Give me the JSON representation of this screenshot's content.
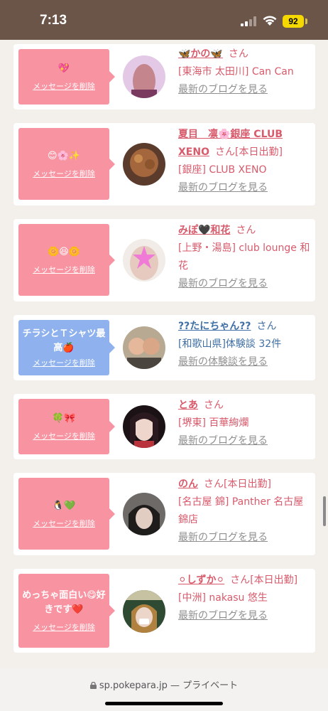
{
  "status_bar": {
    "time": "7:13",
    "battery": "92"
  },
  "common": {
    "delete_label": "メッセージを削除",
    "san": "さん"
  },
  "cards": [
    {
      "message": "💖",
      "name": "🦋かの🦋",
      "extra": "",
      "shop": "[東海市 太田川] Can Can",
      "link": "最新のブログを見る"
    },
    {
      "message": "😊🌸✨",
      "name": "夏目　凛🌸銀座 CLUB XENO",
      "extra": "[本日出勤]",
      "shop": "[銀座] CLUB XENO",
      "link": "最新のブログを見る"
    },
    {
      "message": "🌼😆🌼",
      "name": "みぽ🖤和花",
      "extra": "",
      "shop": "[上野・湯島] club lounge 和花",
      "link": "最新のブログを見る"
    },
    {
      "message": "チラシとＴシャツ最高🍎",
      "name": "??たにちゃん??",
      "extra": "",
      "shop": "[和歌山県]体験談 32件",
      "link": "最新の体験談を見る"
    },
    {
      "message": "🍀🎀",
      "name": "とあ",
      "extra": "",
      "shop": "[堺東] 百華絢爛",
      "link": "最新のブログを見る"
    },
    {
      "message": "🐧💚",
      "name": "のん",
      "extra": "[本日出勤]",
      "shop": "[名古屋 錦] Panther 名古屋錦店",
      "link": "最新のブログを見る"
    },
    {
      "message": "めっちゃ面白い😋好きです❤️",
      "name": "⚪しずか⚪",
      "extra": "[本日出勤]",
      "shop": "[中洲] nakasu 悠生",
      "link": "最新のブログを見る"
    }
  ],
  "bottom_bar": {
    "url": "sp.pokepara.jp",
    "separator": " — ",
    "mode": "プライベート"
  }
}
